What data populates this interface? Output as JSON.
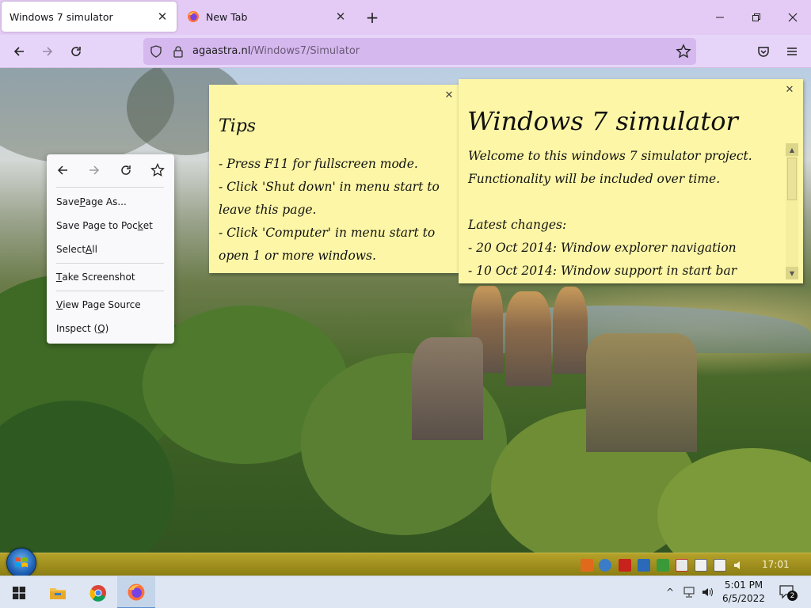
{
  "browser": {
    "tabs": [
      {
        "label": "Windows 7 simulator",
        "active": true
      },
      {
        "label": "New Tab",
        "active": false
      }
    ],
    "url": {
      "domain": "agaastra.nl",
      "path": "/Windows7/Simulator"
    },
    "accent": "#e4cbf5"
  },
  "context_menu": {
    "items": [
      {
        "pre": "Save ",
        "key": "P",
        "post": "age As..."
      },
      {
        "pre": "Save Page to Poc",
        "key": "k",
        "post": "et"
      },
      {
        "pre": "Select ",
        "key": "A",
        "post": "ll"
      },
      {
        "pre": "",
        "key": "T",
        "post": "ake Screenshot"
      },
      {
        "pre": "",
        "key": "V",
        "post": "iew Page Source"
      },
      {
        "pre": "Inspect (",
        "key": "Q",
        "post": ")"
      }
    ]
  },
  "tips_note": {
    "title": "Tips",
    "lines": [
      "- Press F11 for fullscreen mode.",
      "- Click 'Shut down' in menu start to leave this page.",
      "- Click 'Computer' in menu start to open 1 or more windows."
    ]
  },
  "main_note": {
    "title": "Windows 7 simulator",
    "intro": "Welcome to this windows 7 simulator project. Functionality will be included over time.",
    "changes_heading": "Latest changes:",
    "changes": [
      "- 20 Oct 2014: Window explorer navigation",
      "- 10 Oct 2014: Window support in start bar"
    ]
  },
  "win7_taskbar": {
    "clock": "17:01"
  },
  "taskbar": {
    "time": "5:01 PM",
    "date": "6/5/2022",
    "notification_count": "2"
  }
}
